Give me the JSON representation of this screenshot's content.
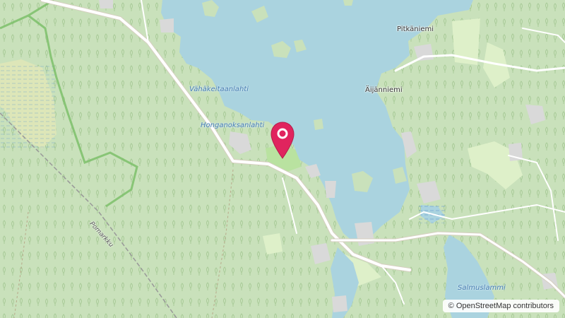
{
  "map": {
    "labels": {
      "pitkaniemi": "Pitkäniemi",
      "aijanniemi": "Äijänniemi",
      "vahakeitaanlahti": "Vähäkeitaanlahti",
      "honganoksanlahti": "Honganoksanlahti",
      "pomarkku": "Pomarkku",
      "salmuslammi": "Salmuslammi"
    },
    "marker": {
      "color": "#e0245e"
    },
    "colors": {
      "forest": "#c9e1bb",
      "water": "#aad3df",
      "meadow": "#def0c9",
      "road": "#ffffff"
    }
  },
  "attribution": {
    "symbol": "©",
    "text": "OpenStreetMap contributors"
  }
}
